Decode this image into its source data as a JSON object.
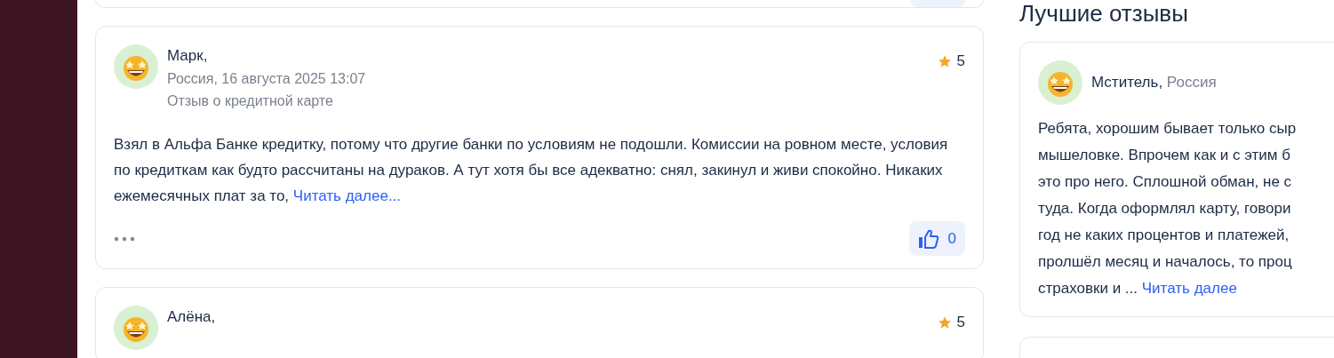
{
  "reviews": [
    {
      "author": "Марк,",
      "meta": "Россия, 16 августа 2025 13:07",
      "subject": "Отзыв о кредитной карте",
      "rating": "5",
      "text": "Взял в Альфа Банке кредитку, потому что другие банки по условиям не подошли. Комиссии на ровном месте, условия по кредиткам как будто рассчитаны на дураков. А тут хотя бы все адекватно: снял, закинул и живи спокойно. Никаких ежемесячных плат за то,",
      "more": "Читать далее...",
      "likes": "0"
    },
    {
      "author": "Алёна,",
      "rating": "5"
    }
  ],
  "best_reviews": {
    "title": "Лучшие отзывы",
    "items": [
      {
        "author": "Мститель,",
        "location": "Россия",
        "lines": [
          "Ребята, хорошим бывает только сыр",
          "мышеловке. Впрочем как и с этим б",
          "это про него. Сплошной обман, не с",
          "туда. Когда оформлял карту, говори",
          "год не каких процентов и платежей,",
          "пролшёл месяц и началось, то проц",
          "страховки и ..."
        ],
        "more": "Читать далее"
      }
    ]
  }
}
